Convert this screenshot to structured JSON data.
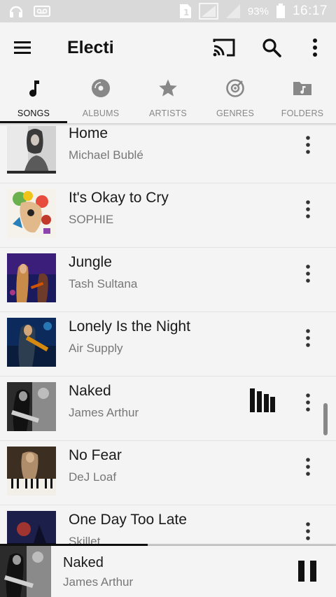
{
  "status_bar": {
    "battery_percent": "93%",
    "time": "16:17",
    "icons": [
      "headphones-icon",
      "voicemail-icon",
      "sim-1-icon",
      "signal-icon",
      "signal-empty-icon",
      "battery-icon"
    ]
  },
  "app_bar": {
    "title": "Electi",
    "icons": [
      "menu-icon",
      "cast-icon",
      "search-icon",
      "more-vert-icon"
    ]
  },
  "tabs": [
    {
      "label": "SONGS",
      "icon": "music-note-icon",
      "active": true
    },
    {
      "label": "ALBUMS",
      "icon": "disc-icon",
      "active": false
    },
    {
      "label": "ARTISTS",
      "icon": "star-icon",
      "active": false
    },
    {
      "label": "GENRES",
      "icon": "target-disc-icon",
      "active": false
    },
    {
      "label": "FOLDERS",
      "icon": "music-folder-icon",
      "active": false
    }
  ],
  "songs": [
    {
      "title": "Home",
      "artist": "Michael Bublé"
    },
    {
      "title": "It's Okay to Cry",
      "artist": "SOPHIE"
    },
    {
      "title": "Jungle",
      "artist": "Tash Sultana"
    },
    {
      "title": "Lonely Is the Night",
      "artist": "Air Supply"
    },
    {
      "title": "Naked",
      "artist": "James Arthur",
      "playing": true
    },
    {
      "title": "No Fear",
      "artist": "DeJ Loaf"
    },
    {
      "title": "One Day Too Late",
      "artist": "Skillet"
    }
  ],
  "now_playing": {
    "title": "Naked",
    "artist": "James Arthur",
    "progress_fraction": 0.44
  },
  "colors": {
    "background": "#f4f4f4",
    "status_bar": "#d9d9d9",
    "text_primary": "#1a1a1a",
    "text_secondary": "#777777",
    "accent": "#111111"
  }
}
